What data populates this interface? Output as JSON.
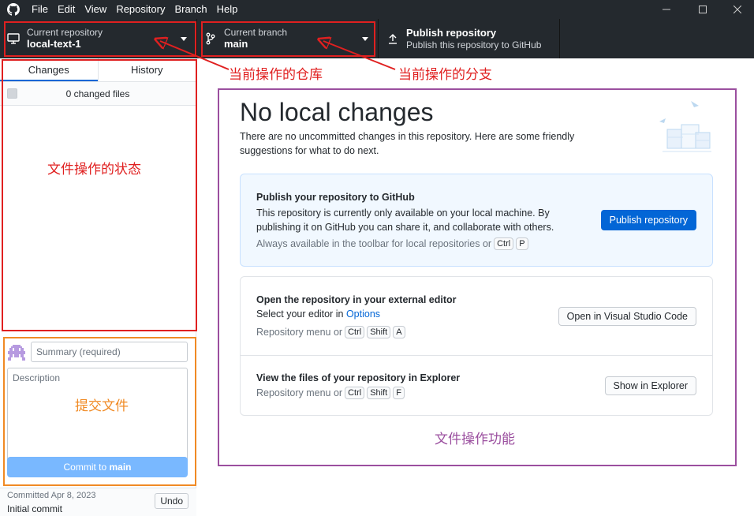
{
  "menu": [
    "File",
    "Edit",
    "View",
    "Repository",
    "Branch",
    "Help"
  ],
  "toolbar": {
    "repo_label": "Current repository",
    "repo_value": "local-text-1",
    "branch_label": "Current branch",
    "branch_value": "main",
    "publish_title": "Publish repository",
    "publish_sub": "Publish this repository to GitHub"
  },
  "sidebar": {
    "tabs": [
      "Changes",
      "History"
    ],
    "changed_files": "0 changed files",
    "summary_placeholder": "Summary (required)",
    "description_placeholder": "Description",
    "commit_prefix": "Commit to ",
    "commit_branch": "main",
    "last_commit_date": "Committed Apr 8, 2023",
    "last_commit_msg": "Initial commit",
    "undo": "Undo"
  },
  "main": {
    "title": "No local changes",
    "subtitle": "There are no uncommitted changes in this repository. Here are some friendly suggestions for what to do next.",
    "publish_card": {
      "heading": "Publish your repository to GitHub",
      "body": "This repository is currently only available on your local machine. By publishing it on GitHub you can share it, and collaborate with others.",
      "hint": "Always available in the toolbar for local repositories or",
      "keys": [
        "Ctrl",
        "P"
      ],
      "button": "Publish repository"
    },
    "editor_card": {
      "heading": "Open the repository in your external editor",
      "body_prefix": "Select your editor in ",
      "body_link": "Options",
      "hint": "Repository menu or",
      "keys": [
        "Ctrl",
        "Shift",
        "A"
      ],
      "button": "Open in Visual Studio Code"
    },
    "explorer_card": {
      "heading": "View the files of your repository in Explorer",
      "hint": "Repository menu or",
      "keys": [
        "Ctrl",
        "Shift",
        "F"
      ],
      "button": "Show in Explorer"
    }
  },
  "annotations": {
    "repo": "当前操作的仓库",
    "branch": "当前操作的分支",
    "file_status": "文件操作的状态",
    "commit": "提交文件",
    "function": "文件操作功能"
  },
  "colors": {
    "red": "#e02020",
    "orange": "#f08a24",
    "purple": "#9b4f9f",
    "accent": "#0366d6",
    "toolbar_bg": "#24292e"
  }
}
